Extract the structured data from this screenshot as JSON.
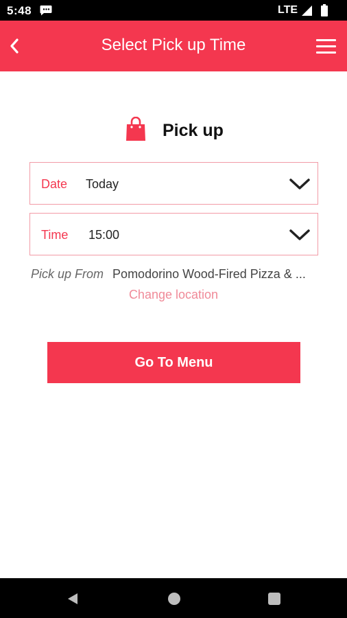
{
  "status_bar": {
    "time": "5:48",
    "network": "LTE",
    "icons": [
      "message-icon",
      "signal-icon",
      "battery-icon"
    ]
  },
  "app_bar": {
    "title": "Select Pick up Time",
    "back_icon": "chevron-left-icon",
    "menu_icon": "hamburger-menu-icon",
    "background_color": "#f4374f"
  },
  "pickup": {
    "icon": "shopping-bag-icon",
    "title": "Pick up"
  },
  "fields": {
    "date": {
      "label": "Date",
      "value": "Today",
      "icon": "chevron-down-icon"
    },
    "time": {
      "label": "Time",
      "value": "15:00",
      "icon": "chevron-down-icon"
    }
  },
  "location": {
    "label": "Pick up From",
    "value": "Pomodorino Wood-Fired Pizza & ...",
    "change_link": "Change location"
  },
  "actions": {
    "go_to_menu": "Go To Menu"
  },
  "nav_bar": {
    "icons": [
      "nav-back-icon",
      "nav-home-icon",
      "nav-recent-apps-icon"
    ]
  },
  "colors": {
    "accent": "#f4374f",
    "field_border": "#f29aa6",
    "link": "#f08a98"
  }
}
